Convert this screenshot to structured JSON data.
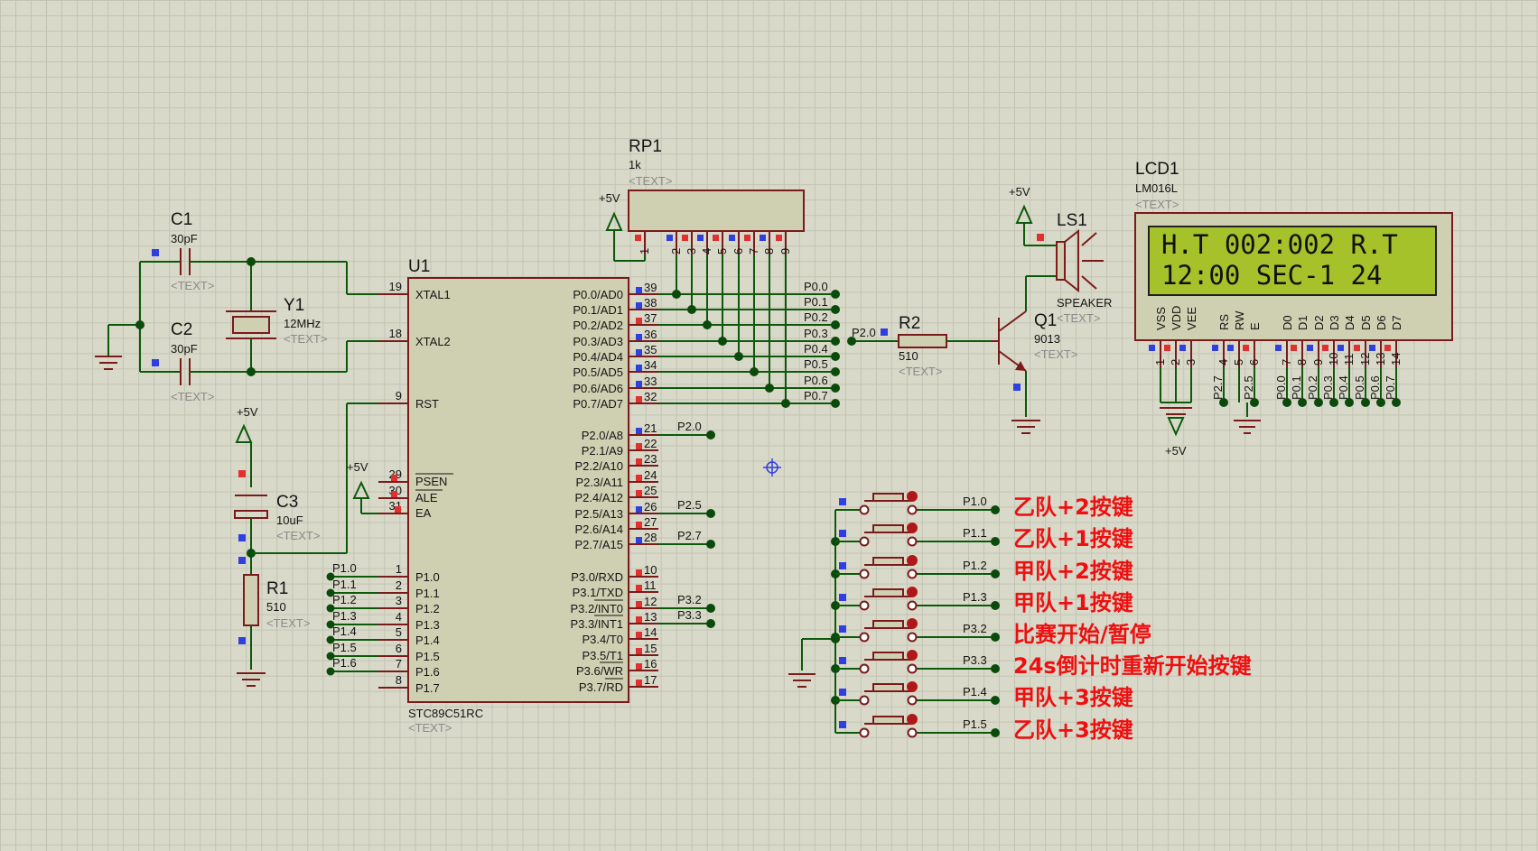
{
  "mcu": {
    "ref": "U1",
    "part": "STC89C51RC",
    "text_placeholder": "<TEXT>",
    "left_pins": [
      {
        "num": "19",
        "name": "XTAL1"
      },
      {
        "num": "18",
        "name": "XTAL2"
      },
      {
        "num": "9",
        "name": "RST"
      },
      {
        "num": "29",
        "name": "PSEN"
      },
      {
        "num": "30",
        "name": "ALE"
      },
      {
        "num": "31",
        "name": "EA"
      },
      {
        "num": "1",
        "name": "P1.0"
      },
      {
        "num": "2",
        "name": "P1.1"
      },
      {
        "num": "3",
        "name": "P1.2"
      },
      {
        "num": "4",
        "name": "P1.3"
      },
      {
        "num": "5",
        "name": "P1.4"
      },
      {
        "num": "6",
        "name": "P1.5"
      },
      {
        "num": "7",
        "name": "P1.6"
      },
      {
        "num": "8",
        "name": "P1.7"
      }
    ],
    "right_pins": [
      {
        "num": "39",
        "name": "P0.0/AD0"
      },
      {
        "num": "38",
        "name": "P0.1/AD1"
      },
      {
        "num": "37",
        "name": "P0.2/AD2"
      },
      {
        "num": "36",
        "name": "P0.3/AD3"
      },
      {
        "num": "35",
        "name": "P0.4/AD4"
      },
      {
        "num": "34",
        "name": "P0.5/AD5"
      },
      {
        "num": "33",
        "name": "P0.6/AD6"
      },
      {
        "num": "32",
        "name": "P0.7/AD7"
      },
      {
        "num": "21",
        "name": "P2.0/A8"
      },
      {
        "num": "22",
        "name": "P2.1/A9"
      },
      {
        "num": "23",
        "name": "P2.2/A10"
      },
      {
        "num": "24",
        "name": "P2.3/A11"
      },
      {
        "num": "25",
        "name": "P2.4/A12"
      },
      {
        "num": "26",
        "name": "P2.5/A13"
      },
      {
        "num": "27",
        "name": "P2.6/A14"
      },
      {
        "num": "28",
        "name": "P2.7/A15"
      },
      {
        "num": "10",
        "name": "P3.0/RXD"
      },
      {
        "num": "11",
        "name": "P3.1/TXD"
      },
      {
        "num": "12",
        "name": "P3.2/INT0"
      },
      {
        "num": "13",
        "name": "P3.3/INT1"
      },
      {
        "num": "14",
        "name": "P3.4/T0"
      },
      {
        "num": "15",
        "name": "P3.5/T1"
      },
      {
        "num": "16",
        "name": "P3.6/WR"
      },
      {
        "num": "17",
        "name": "P3.7/RD"
      }
    ],
    "p1_net_labels": [
      "P1.0",
      "P1.1",
      "P1.2",
      "P1.3",
      "P1.4",
      "P1.5",
      "P1.6"
    ],
    "p0_net_labels": [
      "P0.0",
      "P0.1",
      "P0.2",
      "P0.3",
      "P0.4",
      "P0.5",
      "P0.6",
      "P0.7"
    ],
    "p2_net_labels": {
      "p20": "P2.0",
      "p25": "P2.5",
      "p27": "P2.7"
    },
    "p3_net_labels": {
      "p32": "P3.2",
      "p33": "P3.3"
    }
  },
  "c1": {
    "ref": "C1",
    "value": "30pF",
    "text": "<TEXT>"
  },
  "c2": {
    "ref": "C2",
    "value": "30pF",
    "text": "<TEXT>"
  },
  "y1": {
    "ref": "Y1",
    "value": "12MHz",
    "text": "<TEXT>"
  },
  "c3": {
    "ref": "C3",
    "value": "10uF",
    "text": "<TEXT>"
  },
  "r1": {
    "ref": "R1",
    "value": "510",
    "text": "<TEXT>"
  },
  "r2": {
    "ref": "R2",
    "value": "510",
    "text": "<TEXT>"
  },
  "q1": {
    "ref": "Q1",
    "value": "9013",
    "text": "<TEXT>"
  },
  "ls1": {
    "ref": "LS1",
    "value": "SPEAKER",
    "text": "<TEXT>"
  },
  "rp1": {
    "ref": "RP1",
    "value": "1k",
    "text": "<TEXT>",
    "pins": [
      "1",
      "2",
      "3",
      "4",
      "5",
      "6",
      "7",
      "8",
      "9"
    ]
  },
  "power": {
    "vcc": "+5V"
  },
  "lcd": {
    "ref": "LCD1",
    "part": "LM016L",
    "text": "<TEXT>",
    "line1": "H.T 002:002 R.T",
    "line2": "12:00  SEC-1  24",
    "pin_names": [
      "VSS",
      "VDD",
      "VEE",
      "RS",
      "RW",
      "E",
      "D0",
      "D1",
      "D2",
      "D3",
      "D4",
      "D5",
      "D6",
      "D7"
    ],
    "pin_nums": [
      "1",
      "2",
      "3",
      "4",
      "5",
      "6",
      "7",
      "8",
      "9",
      "10",
      "11",
      "12",
      "13",
      "14"
    ],
    "net_labels": [
      "P2.7",
      "P2.5",
      "P0.0",
      "P0.1",
      "P0.2",
      "P0.3",
      "P0.4",
      "P0.5",
      "P0.6",
      "P0.7"
    ]
  },
  "buttons": [
    {
      "net": "P1.0",
      "label": "乙队+2按键"
    },
    {
      "net": "P1.1",
      "label": "乙队+1按键"
    },
    {
      "net": "P1.2",
      "label": "甲队+2按键"
    },
    {
      "net": "P1.3",
      "label": "甲队+1按键"
    },
    {
      "net": "P3.2",
      "label": "比赛开始/暂停"
    },
    {
      "net": "P3.3",
      "label": " 24s倒计时重新开始按键"
    },
    {
      "net": "P1.4",
      "label": "甲队+3按键"
    },
    {
      "net": "P1.5",
      "label": "乙队+3按键"
    }
  ],
  "colors": {
    "wire": "#0a5a0a",
    "component": "#7a1a1a",
    "body": "#cfcfb2",
    "annotation": "#ee1010",
    "lcd_screen": "#a6c22a"
  }
}
